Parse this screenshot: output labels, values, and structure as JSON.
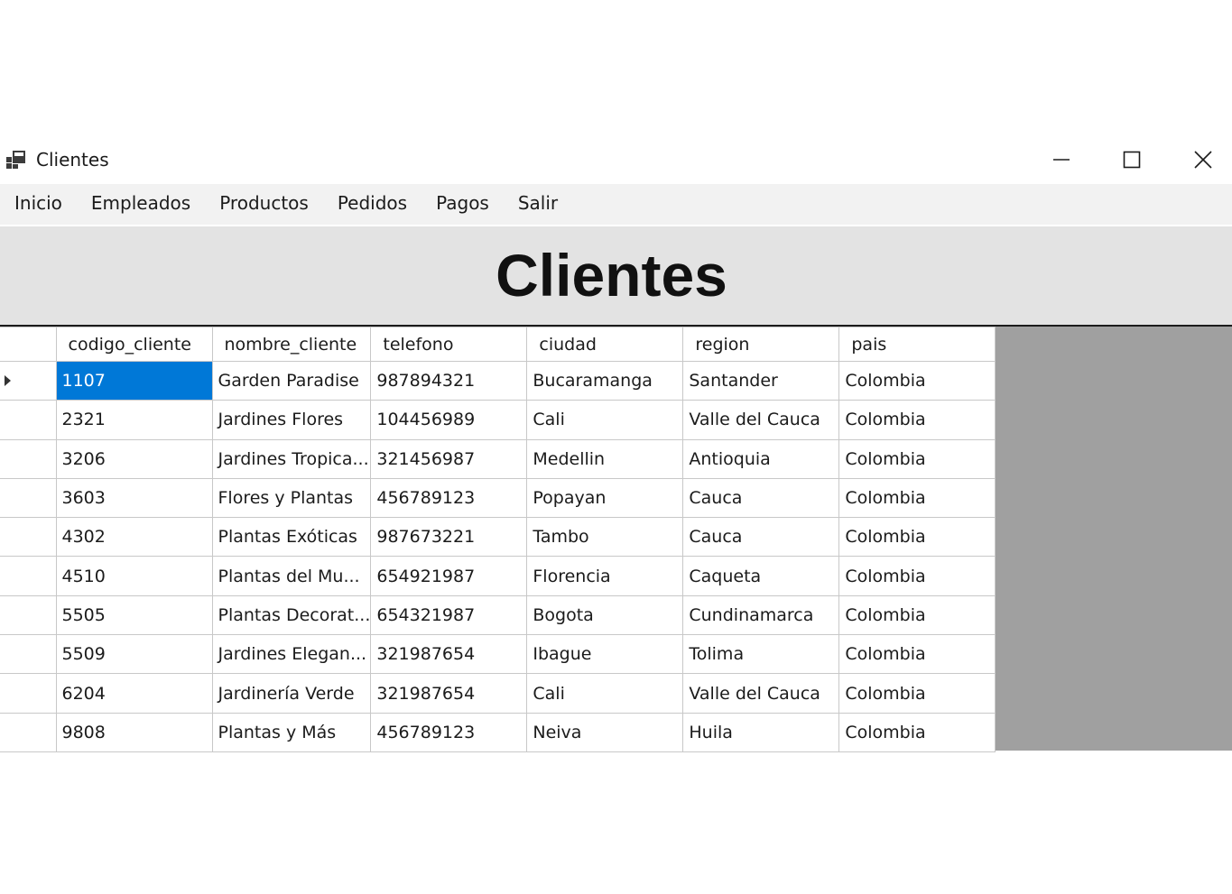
{
  "window": {
    "title": "Clientes",
    "icon": "app-window-icon",
    "controls": [
      "minimize-icon",
      "maximize-icon",
      "close-icon"
    ]
  },
  "menu": {
    "items": [
      {
        "label": "Inicio"
      },
      {
        "label": "Empleados"
      },
      {
        "label": "Productos"
      },
      {
        "label": "Pedidos"
      },
      {
        "label": "Pagos"
      },
      {
        "label": "Salir"
      }
    ]
  },
  "header": {
    "title": "Clientes"
  },
  "grid": {
    "columns": [
      "codigo_cliente",
      "nombre_cliente",
      "telefono",
      "ciudad",
      "region",
      "pais"
    ],
    "selected_row": 0,
    "selection_color": "#0078d7",
    "rows": [
      [
        "1107",
        "Garden Paradise",
        "987894321",
        "Bucaramanga",
        "Santander",
        "Colombia"
      ],
      [
        "2321",
        "Jardines Flores",
        "104456989",
        "Cali",
        "Valle del Cauca",
        "Colombia"
      ],
      [
        "3206",
        "Jardines Tropica...",
        "321456987",
        "Medellin",
        "Antioquia",
        "Colombia"
      ],
      [
        "3603",
        "Flores y Plantas",
        "456789123",
        "Popayan",
        "Cauca",
        "Colombia"
      ],
      [
        "4302",
        "Plantas Exóticas",
        "987673221",
        "Tambo",
        "Cauca",
        "Colombia"
      ],
      [
        "4510",
        "Plantas del Mu...",
        "654921987",
        "Florencia",
        "Caqueta",
        "Colombia"
      ],
      [
        "5505",
        "Plantas Decorat...",
        "654321987",
        "Bogota",
        "Cundinamarca",
        "Colombia"
      ],
      [
        "5509",
        "Jardines Elegan...",
        "321987654",
        "Ibague",
        "Tolima",
        "Colombia"
      ],
      [
        "6204",
        "Jardinería Verde",
        "321987654",
        "Cali",
        "Valle del Cauca",
        "Colombia"
      ],
      [
        "9808",
        "Plantas y Más",
        "456789123",
        "Neiva",
        "Huila",
        "Colombia"
      ]
    ]
  }
}
